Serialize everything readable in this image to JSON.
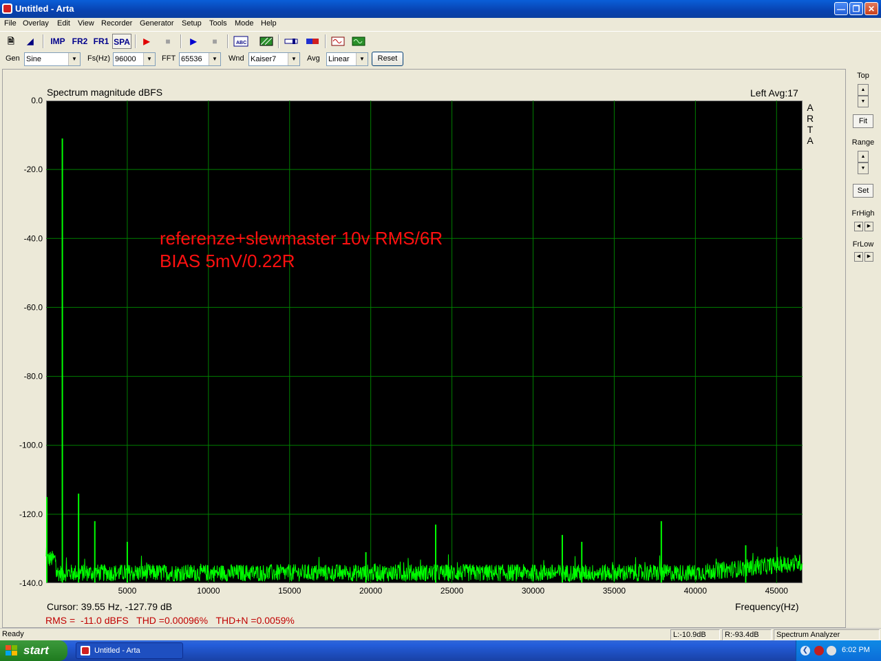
{
  "window": {
    "title": "Untitled - Arta"
  },
  "menu": [
    "File",
    "Overlay",
    "Edit",
    "View",
    "Recorder",
    "Generator",
    "Setup",
    "Tools",
    "Mode",
    "Help"
  ],
  "toolbar": {
    "imp": "IMP",
    "fr2": "FR2",
    "fr1": "FR1",
    "spa": "SPA"
  },
  "params": {
    "gen_label": "Gen",
    "gen_value": "Sine",
    "fs_label": "Fs(Hz)",
    "fs_value": "96000",
    "fft_label": "FFT",
    "fft_value": "65536",
    "wnd_label": "Wnd",
    "wnd_value": "Kaiser7",
    "avg_label": "Avg",
    "avg_value": "Linear",
    "reset_label": "Reset"
  },
  "side_panel": {
    "top": "Top",
    "fit": "Fit",
    "range": "Range",
    "set": "Set",
    "frhigh": "FrHigh",
    "frlow": "FrLow"
  },
  "chart_header": {
    "title": "Spectrum magnitude dBFS",
    "channel": "Left  Avg:17",
    "vertical": [
      "A",
      "R",
      "T",
      "A"
    ]
  },
  "annotation": {
    "line1": "referenze+slewmaster 10v RMS/6R",
    "line2": "BIAS 5mV/0.22R"
  },
  "readouts": {
    "cursor": "Cursor: 39.55 Hz, -127.79 dB",
    "measurements": "RMS =  -11.0 dBFS   THD =0.00096%   THD+N =0.0059%"
  },
  "status": {
    "ready": "Ready",
    "left_level": "L:-10.9dB",
    "right_level": "R:-93.4dB",
    "mode": "Spectrum Analyzer"
  },
  "taskbar": {
    "start": "start",
    "task": "Untitled - Arta",
    "clock": "6:02 PM"
  },
  "colors": {
    "trace": "#00ff00",
    "grid": "#008000",
    "annotation": "#ff1010",
    "plot_bg": "#000000"
  },
  "chart_data": {
    "type": "line",
    "title": "Spectrum magnitude dBFS",
    "xlabel": "Frequency(Hz)",
    "ylabel": "",
    "xlim": [
      0,
      46600
    ],
    "ylim": [
      -140,
      0
    ],
    "yticks": [
      0,
      -20,
      -40,
      -60,
      -80,
      -100,
      -120,
      -140
    ],
    "ytick_labels": [
      "0.0",
      "-20.0",
      "-40.0",
      "-60.0",
      "-80.0",
      "-100.0",
      "-120.0",
      "-140.0"
    ],
    "xticks": [
      5000,
      10000,
      15000,
      20000,
      25000,
      30000,
      35000,
      40000,
      45000
    ],
    "xtick_labels": [
      "5000",
      "10000",
      "15000",
      "20000",
      "25000",
      "30000",
      "35000",
      "40000",
      "45000"
    ],
    "grid": true,
    "noise_floor_db": -137,
    "peaks": [
      {
        "f": 0,
        "db": -115
      },
      {
        "f": 1000,
        "db": -11
      },
      {
        "f": 2000,
        "db": -114
      },
      {
        "f": 3000,
        "db": -122
      },
      {
        "f": 5000,
        "db": -128
      },
      {
        "f": 19700,
        "db": -131
      },
      {
        "f": 24000,
        "db": -123
      },
      {
        "f": 31800,
        "db": -126
      },
      {
        "f": 33000,
        "db": -128
      },
      {
        "f": 37900,
        "db": -122
      },
      {
        "f": 43100,
        "db": -129
      }
    ]
  }
}
